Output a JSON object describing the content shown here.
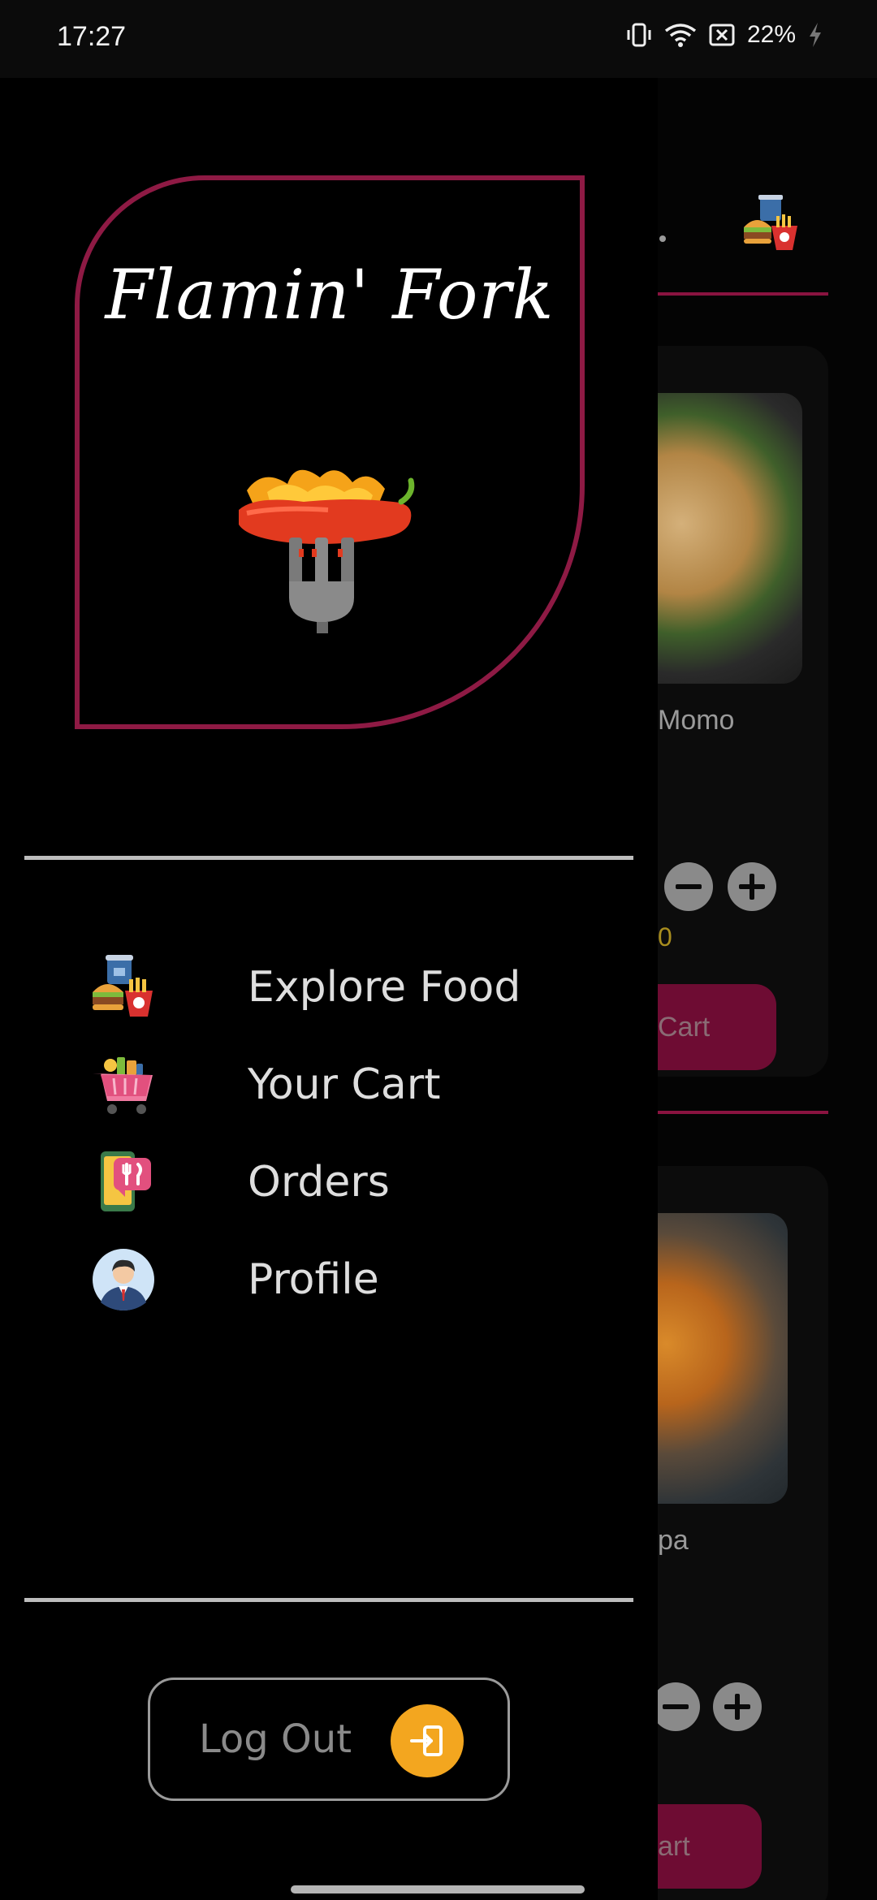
{
  "status_bar": {
    "time": "17:27",
    "battery": "22%"
  },
  "drawer": {
    "brand_title": "Flamin' Fork",
    "menu": [
      {
        "label": "Explore Food",
        "icon": "food-combo-icon"
      },
      {
        "label": "Your Cart",
        "icon": "shopping-cart-icon"
      },
      {
        "label": "Orders",
        "icon": "orders-phone-icon"
      },
      {
        "label": "Profile",
        "icon": "profile-avatar-icon"
      }
    ],
    "logout_label": "Log Out"
  },
  "background": {
    "item1_name_fragment": "Momo",
    "item1_price_fragment": "0",
    "item1_button_fragment": "Cart",
    "item2_name_fragment": "pa",
    "item2_button_fragment": "art"
  },
  "colors": {
    "accent": "#8e1a44",
    "logout_icon_bg": "#f3a61f",
    "price": "#a88d1e"
  }
}
